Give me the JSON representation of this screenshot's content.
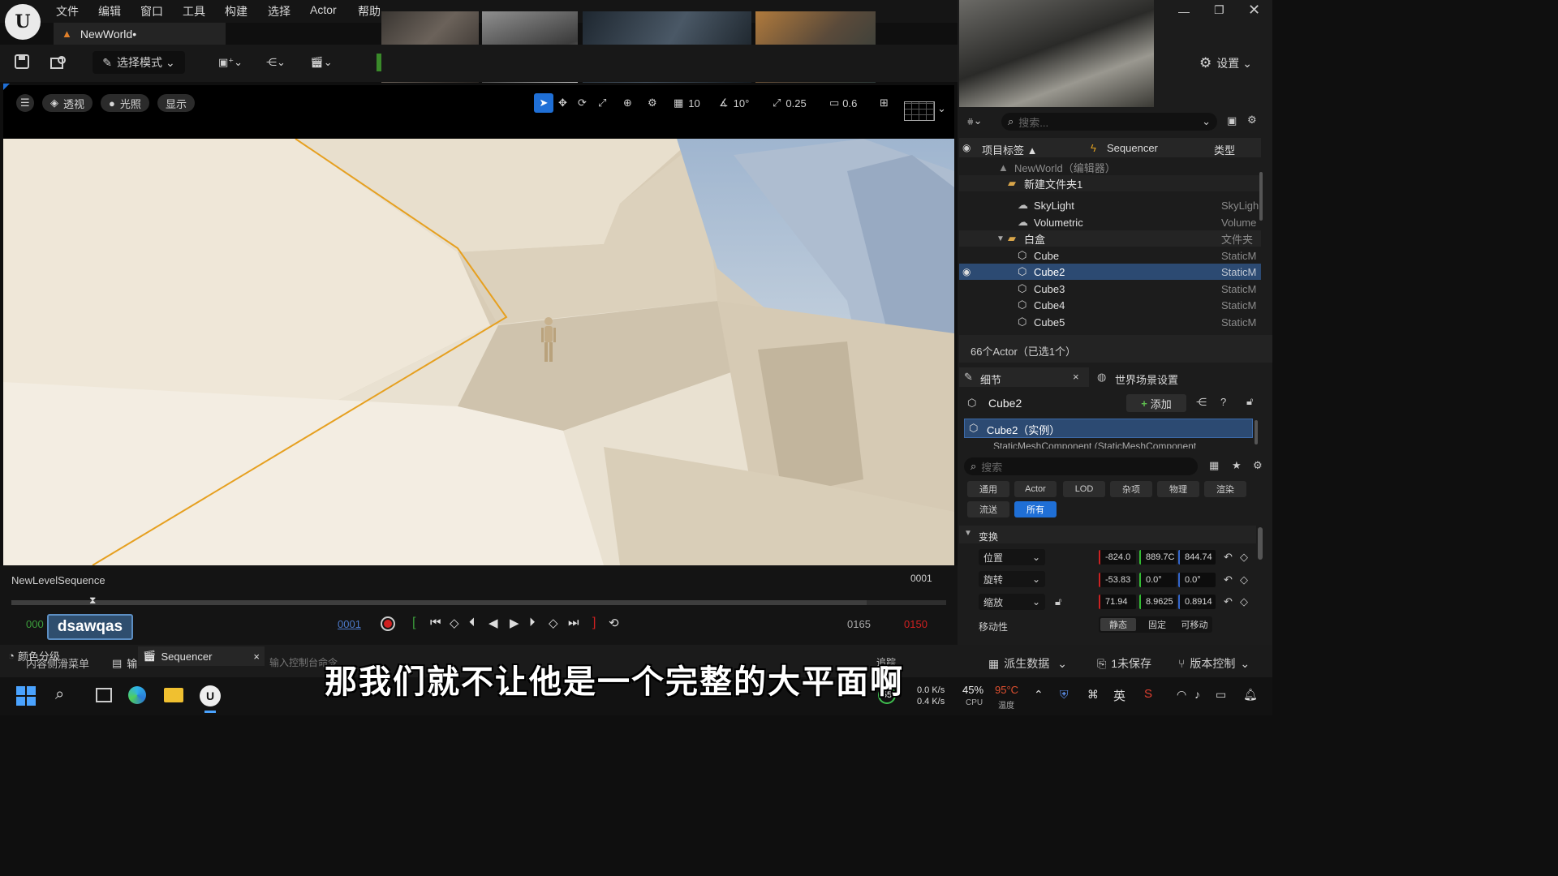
{
  "menu": [
    "文件",
    "编辑",
    "窗口",
    "工具",
    "构建",
    "选择",
    "Actor",
    "帮助"
  ],
  "doc_tab": "NewWorld•",
  "toolbar": {
    "mode_label": "选择模式"
  },
  "viewport": {
    "perspective": "透视",
    "lighting": "光照",
    "show": "显示",
    "grid_snap": "10",
    "rotate_snap": "10°",
    "scale_snap": "0.25",
    "camera_speed": "0.6"
  },
  "sequencer": {
    "name": "NewLevelSequence",
    "current_frame": "0001",
    "start_left": "000",
    "overlay_text": "dsawqas",
    "playhead_frame": "0001",
    "end_frame": "0165",
    "end_marker": "0150"
  },
  "bottom_bar": {
    "tab1": "颜色分级",
    "tab1_sub": "内容侧滑菜单",
    "tab2": "输",
    "tab3": "Sequencer",
    "console_placeholder": "输入控制台命令",
    "tab4": "追踪",
    "derived": "派生数据",
    "unsaved": "1未保存",
    "version": "版本控制"
  },
  "subtitle": "那我们就不让他是一个完整的大平面啊",
  "outliner": {
    "settings": "设置",
    "search_placeholder": "搜索...",
    "col_label": "项目标签 ▲",
    "col_seq": "Sequencer",
    "col_type": "类型",
    "rows": [
      {
        "name": "NewWorld（编辑器）",
        "type": "",
        "indent": 0
      },
      {
        "name": "新建文件夹1",
        "type": "",
        "indent": 1
      },
      {
        "name": "SkyLight",
        "type": "SkyLigh",
        "indent": 2
      },
      {
        "name": "Volumetric",
        "type": "Volume",
        "indent": 2
      },
      {
        "name": "白盒",
        "type": "文件夹",
        "indent": 1
      },
      {
        "name": "Cube",
        "type": "StaticM",
        "indent": 2
      },
      {
        "name": "Cube2",
        "type": "StaticM",
        "indent": 2,
        "selected": true
      },
      {
        "name": "Cube3",
        "type": "StaticM",
        "indent": 2
      },
      {
        "name": "Cube4",
        "type": "StaticM",
        "indent": 2
      },
      {
        "name": "Cube5",
        "type": "StaticM",
        "indent": 2
      }
    ],
    "count": "66个Actor（已选1个）"
  },
  "details": {
    "tab": "细节",
    "world_tab": "世界场景设置",
    "actor_name": "Cube2",
    "add_label": "添加",
    "instance": "Cube2（实例）",
    "component": "StaticMeshComponent (StaticMeshComponent",
    "search_placeholder": "搜索",
    "filters": [
      "通用",
      "Actor",
      "LOD",
      "杂项",
      "物理",
      "渲染",
      "流送",
      "所有"
    ],
    "section": "变换",
    "location_label": "位置",
    "location": [
      "-824.0",
      "889.7C",
      "844.74"
    ],
    "rotation_label": "旋转",
    "rotation": [
      "-53.83",
      "0.0°",
      "0.0°"
    ],
    "scale_label": "缩放",
    "scale": [
      "71.94",
      "8.9625",
      "0.8914"
    ],
    "mobility_label": "移动性",
    "mobility": [
      "静态",
      "固定",
      "可移动"
    ]
  },
  "taskbar": {
    "cpu": "45%",
    "cpu_label": "CPU",
    "temp": "95°C",
    "temp_label": "温度",
    "net_up": "0.0 K/s",
    "net_down": "0.4 K/s",
    "badge": "55",
    "ime": "英"
  },
  "colors": {
    "accent": "#1f6fd6",
    "selection": "#2c4a72",
    "spline": "#e6a020"
  }
}
